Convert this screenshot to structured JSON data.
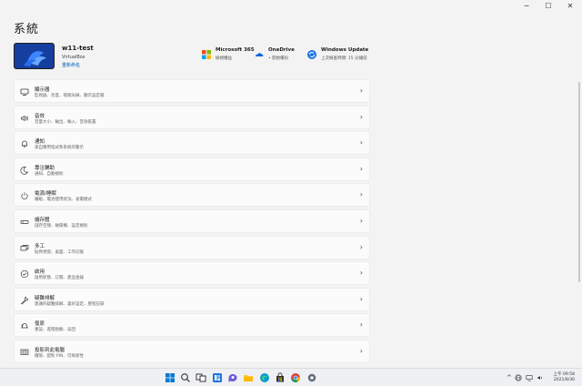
{
  "window": {
    "title": "系統",
    "controls": {
      "minimize": "─",
      "maximize": "☐",
      "close": "✕"
    }
  },
  "device": {
    "name": "w11-test",
    "model": "VirtualBox",
    "rename": "重新命名"
  },
  "services": [
    {
      "title": "Microsoft 365",
      "subtitle": "檢視權益",
      "icon": "microsoft-365-icon"
    },
    {
      "title": "OneDrive",
      "subtitle": "• 開始備份",
      "icon": "onedrive-icon"
    },
    {
      "title": "Windows Update",
      "subtitle": "上次檢查時間: 15 分鐘前",
      "icon": "windows-update-icon"
    }
  ],
  "settings": [
    {
      "title": "顯示器",
      "subtitle": "監視器、亮度、夜間光線、顯示設定檔",
      "icon": "display-icon"
    },
    {
      "title": "音效",
      "subtitle": "音量大小、輸出、輸入、音效裝置",
      "icon": "sound-icon"
    },
    {
      "title": "通知",
      "subtitle": "來自應用程式和系統的警示",
      "icon": "notifications-icon"
    },
    {
      "title": "專注輔助",
      "subtitle": "通知、自動規則",
      "icon": "focus-assist-icon"
    },
    {
      "title": "電源/睡眠",
      "subtitle": "睡眠、電池使用狀況、省電模式",
      "icon": "power-icon"
    },
    {
      "title": "儲存體",
      "subtitle": "儲存空間、磁碟機、設定規則",
      "icon": "storage-icon"
    },
    {
      "title": "多工",
      "subtitle": "貼齊視窗、桌面、工作切換",
      "icon": "multitasking-icon"
    },
    {
      "title": "啟用",
      "subtitle": "啟用狀態、訂閱、產品金鑰",
      "icon": "activation-icon"
    },
    {
      "title": "疑難排解",
      "subtitle": "建議的疑難排解、喜好設定、歷程記錄",
      "icon": "troubleshoot-icon"
    },
    {
      "title": "復原",
      "subtitle": "重設、進階啟動、返回",
      "icon": "recovery-icon"
    },
    {
      "title": "投影到此電腦",
      "subtitle": "權限、配對 PIN、可探索性",
      "icon": "projecting-icon"
    }
  ],
  "taskbar": {
    "apps": [
      "windows-start-icon",
      "search-icon",
      "task-view-icon",
      "widgets-icon",
      "chat-icon",
      "file-explorer-icon",
      "edge-icon",
      "store-icon",
      "chrome-icon",
      "settings-icon"
    ],
    "tray": {
      "chevron": "^",
      "time": "上午 09:58",
      "date": "2021/8/30"
    }
  },
  "colors": {
    "accent": "#0067c0",
    "background": "#f3f3f3",
    "card": "#fbfbfb"
  }
}
